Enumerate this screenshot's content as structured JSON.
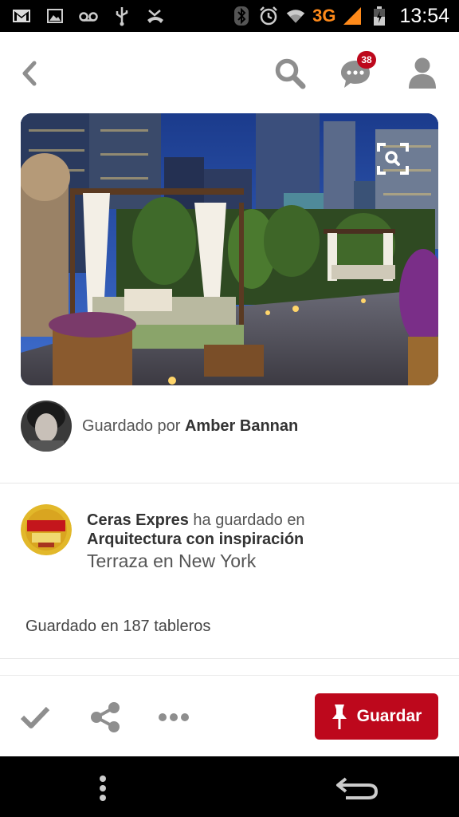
{
  "status_bar": {
    "network": "3G",
    "time": "13:54",
    "icons": [
      "gmail-icon",
      "gallery-icon",
      "voicemail-icon",
      "usb-icon",
      "missed-call-icon",
      "bluetooth-icon",
      "alarm-icon",
      "wifi-icon",
      "signal-icon",
      "battery-icon"
    ]
  },
  "header": {
    "back_icon": "chevron-left-icon",
    "search_icon": "search-icon",
    "messages_icon": "speech-bubble-icon",
    "messages_badge": "38",
    "profile_icon": "person-icon"
  },
  "pin": {
    "image": "rooftop terrace with cabanas at dusk, New York skyline",
    "saved_by_prefix": "Guardado por ",
    "saved_by_name": "Amber Bannan",
    "repin_user": "Ceras Expres",
    "repin_middle": " ha guardado en",
    "board_name": "Arquitectura con inspiración",
    "description": "Terraza en New York",
    "saved_count": "Guardado en 187 tableros"
  },
  "actions": {
    "save_button_label": "Guardar",
    "icons": [
      "checkmark-icon",
      "share-icon",
      "more-icon",
      "pushpin-icon"
    ]
  },
  "nav_bar": {
    "icons": [
      "menu-dots-icon",
      "back-arrow-icon"
    ]
  },
  "colors": {
    "accent": "#bd081c",
    "icon_gray": "#8e8e8e",
    "text": "#333333"
  }
}
